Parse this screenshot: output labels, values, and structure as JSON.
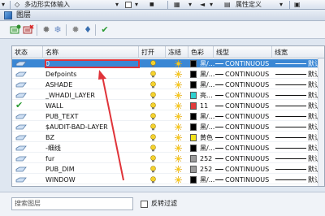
{
  "topbar": {
    "polygon_label": "多边形实体输入",
    "attr_label": "属性定义"
  },
  "window": {
    "title": "图层"
  },
  "table": {
    "headers": [
      "状态",
      "名称",
      "打开",
      "冻结",
      "色彩",
      "线型",
      "线宽"
    ],
    "rows": [
      {
        "name": "0",
        "color_name": "黑/...",
        "color_hex": "#000000",
        "linetype": "CONTINUOUS",
        "lineweight": "默认",
        "selected": true,
        "status": "eye"
      },
      {
        "name": "Defpoints",
        "color_name": "黑/...",
        "color_hex": "#000000",
        "linetype": "CONTINUOUS",
        "lineweight": "默认",
        "selected": false,
        "status": "eye"
      },
      {
        "name": "ASHADE",
        "color_name": "黑/...",
        "color_hex": "#000000",
        "linetype": "CONTINUOUS",
        "lineweight": "默认",
        "selected": false,
        "status": "eye"
      },
      {
        "name": "_WHADI_LAYER",
        "color_name": "亮...",
        "color_hex": "#2fd0d0",
        "linetype": "CONTINUOUS",
        "lineweight": "默认",
        "selected": false,
        "status": "eye"
      },
      {
        "name": "WALL",
        "color_name": "11",
        "color_hex": "#e23b3b",
        "linetype": "CONTINUOUS",
        "lineweight": "默认",
        "selected": false,
        "status": "check"
      },
      {
        "name": "PUB_TEXT",
        "color_name": "黑/...",
        "color_hex": "#000000",
        "linetype": "CONTINUOUS",
        "lineweight": "默认",
        "selected": false,
        "status": "eye"
      },
      {
        "name": "$AUDIT-BAD-LAYER",
        "color_name": "黑/...",
        "color_hex": "#000000",
        "linetype": "CONTINUOUS",
        "lineweight": "默认",
        "selected": false,
        "status": "eye"
      },
      {
        "name": "BZ",
        "color_name": "黄色",
        "color_hex": "#f2e21a",
        "linetype": "CONTINUOUS",
        "lineweight": "默认",
        "selected": false,
        "status": "eye"
      },
      {
        "name": "-细线",
        "color_name": "黑/...",
        "color_hex": "#000000",
        "linetype": "CONTINUOUS",
        "lineweight": "默认",
        "selected": false,
        "status": "eye"
      },
      {
        "name": "fur",
        "color_name": "252",
        "color_hex": "#9a9a9a",
        "linetype": "CONTINUOUS",
        "lineweight": "默认",
        "selected": false,
        "status": "eye"
      },
      {
        "name": "PUB_DIM",
        "color_name": "252",
        "color_hex": "#9a9a9a",
        "linetype": "CONTINUOUS",
        "lineweight": "默认",
        "selected": false,
        "status": "eye"
      },
      {
        "name": "WINDOW",
        "color_name": "黑/...",
        "color_hex": "#000000",
        "linetype": "CONTINUOUS",
        "lineweight": "默认",
        "selected": false,
        "status": "eye"
      }
    ]
  },
  "bottom": {
    "search_placeholder": "搜索图层",
    "invert_label": "反转过滤"
  },
  "colors": {
    "selection": "#3a87d4",
    "annotation": "#e0343a"
  }
}
